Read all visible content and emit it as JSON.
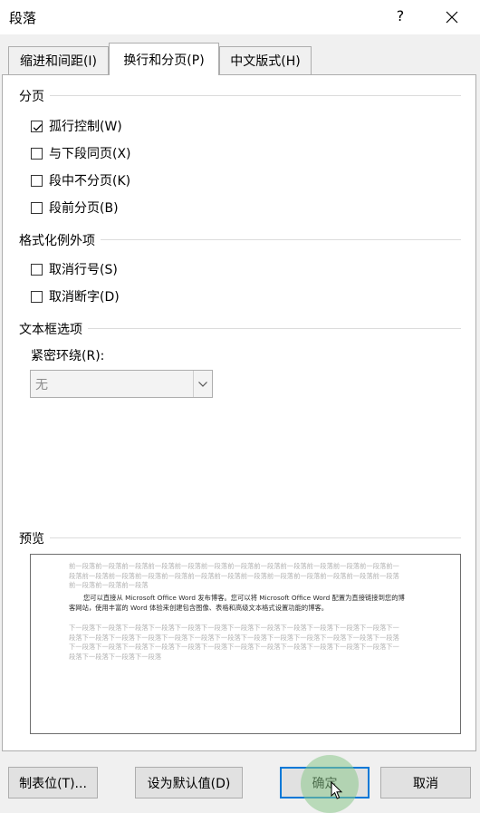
{
  "dialog": {
    "title": "段落",
    "help_glyph": "?"
  },
  "tabs": [
    {
      "label": "缩进和间距(I)",
      "active": false
    },
    {
      "label": "换行和分页(P)",
      "active": true
    },
    {
      "label": "中文版式(H)",
      "active": false
    }
  ],
  "pagination": {
    "heading": "分页",
    "options": [
      {
        "label": "孤行控制(W)",
        "checked": true
      },
      {
        "label": "与下段同页(X)",
        "checked": false
      },
      {
        "label": "段中不分页(K)",
        "checked": false
      },
      {
        "label": "段前分页(B)",
        "checked": false
      }
    ]
  },
  "formatting_exceptions": {
    "heading": "格式化例外项",
    "options": [
      {
        "label": "取消行号(S)",
        "checked": false
      },
      {
        "label": "取消断字(D)",
        "checked": false
      }
    ]
  },
  "textbox_options": {
    "heading": "文本框选项",
    "tight_wrap_label": "紧密环绕(R):",
    "tight_wrap_value": "无"
  },
  "preview": {
    "heading": "预览",
    "prev_text": "前一段落前一段落前一段落前一段落前一段落前一段落前一段落前一段落前一段落前一段落前一段落前一段落前一段落前一段落前一段落前一段落前一段落前一段落前一段落前一段落前一段落前一段落前一段落前一段落前一段落前一段落前一段落前一段落",
    "main_text": "您可以直接从 Microsoft Office Word 发布博客。您可以将 Microsoft Office Word 配置为直接链接到您的博客网站，使用丰富的 Word 体验来创建包含图像、表格和高级文本格式设置功能的博客。",
    "next_text": "下一段落下一段落下一段落下一段落下一段落下一段落下一段落下一段落下一段落下一段落下一段落下一段落下一段落下一段落下一段落下一段落下一段落下一段落下一段落下一段落下一段落下一段落下一段落下一段落下一段落下一段落下一段落下一段落下一段落下一段落下一段落下一段落下一段落下一段落下一段落下一段落下一段落下一段落下一段落下一段落下一段落"
  },
  "buttons": {
    "tabs": "制表位(T)...",
    "set_default": "设为默认值(D)",
    "ok": "确定",
    "cancel": "取消"
  }
}
